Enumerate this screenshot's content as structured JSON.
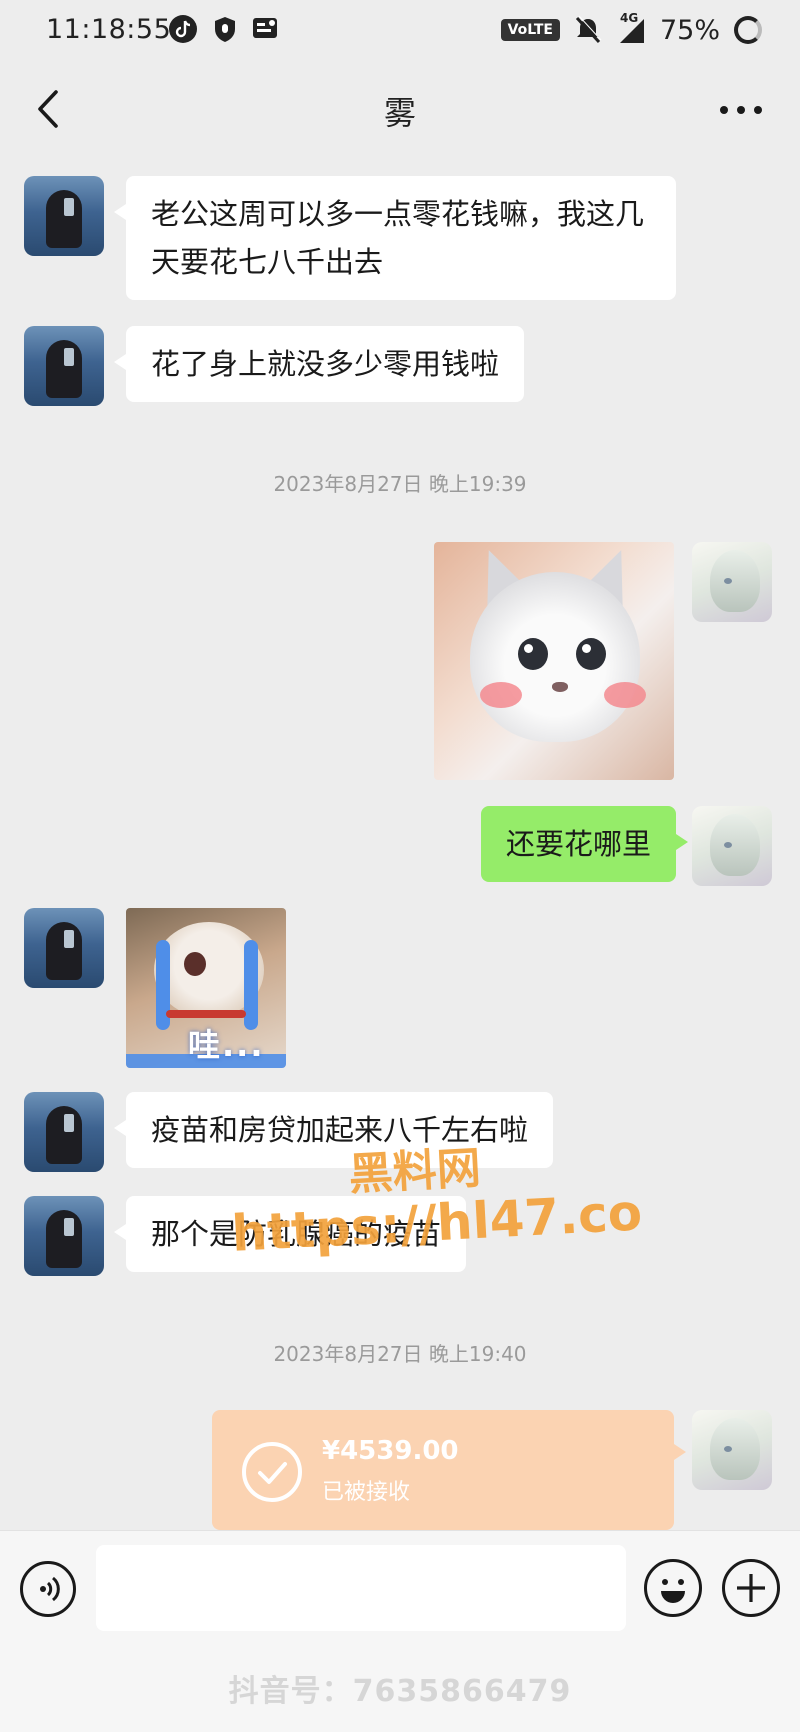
{
  "status_bar": {
    "time": "11:18:55",
    "volte_label": "VoLTE",
    "network_label": "4G",
    "battery": "75%",
    "icons": [
      "tiktok-icon",
      "shield-icon",
      "notification-icon",
      "mute-icon",
      "signal-icon",
      "battery-icon"
    ]
  },
  "nav": {
    "title": "雾",
    "back_icon": "chevron-left-icon",
    "more_icon": "more-dots-icon"
  },
  "messages": [
    {
      "from": "them",
      "type": "text",
      "text": "老公这周可以多一点零花钱嘛，我这几天要花七八千出去"
    },
    {
      "from": "them",
      "type": "text",
      "text": "花了身上就没多少零用钱啦"
    },
    {
      "type": "timestamp",
      "text": "2023年8月27日 晚上19:39"
    },
    {
      "from": "me",
      "type": "sticker",
      "sticker": "cat-blushing-sticker"
    },
    {
      "from": "me",
      "type": "text",
      "text": "还要花哪里"
    },
    {
      "from": "them",
      "type": "sticker",
      "sticker": "crying-hamster-sticker",
      "caption": "哇..."
    },
    {
      "from": "them",
      "type": "text",
      "text": "疫苗和房贷加起来八千左右啦"
    },
    {
      "from": "them",
      "type": "text",
      "text": "那个是防乳腺癌的疫苗"
    },
    {
      "type": "timestamp",
      "text": "2023年8月27日 晚上19:40"
    },
    {
      "from": "me",
      "type": "transfer",
      "amount": "¥4539.00",
      "status": "已被接收"
    }
  ],
  "watermark": {
    "line1": "黑料网",
    "line2": "https://hl47.co"
  },
  "input_bar": {
    "voice_icon": "voice-icon",
    "input_value": "",
    "emoji_icon": "emoji-icon",
    "plus_icon": "plus-icon"
  },
  "footer": {
    "douyin_watermark": "抖音号：7635866479"
  },
  "colors": {
    "background": "#ededed",
    "bubble_them": "#ffffff",
    "bubble_me": "#95ec69",
    "transfer": "#fbd3b2",
    "watermark": "#f3a23c"
  }
}
